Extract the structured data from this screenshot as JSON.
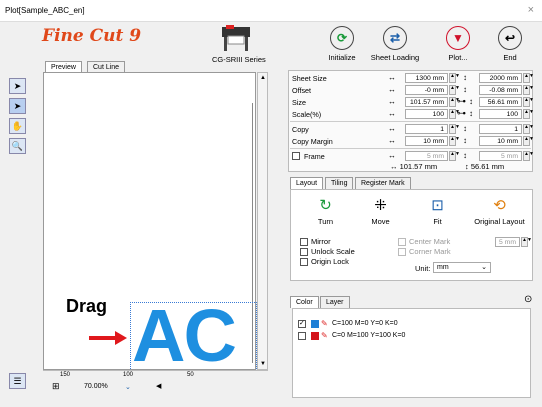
{
  "window": {
    "title": "Plot[Sample_ABC_en]",
    "close": "×"
  },
  "logo": "Fine Cut 9",
  "model": "CG-SRIII Series",
  "toolbar": [
    {
      "label": "Initialize",
      "glyph": "⟳",
      "color": "#1a9a3a"
    },
    {
      "label": "Sheet Loading",
      "glyph": "⇄",
      "color": "#1b5faa"
    },
    {
      "label": "Plot...",
      "glyph": "▼",
      "color": "#d0102a"
    },
    {
      "label": "End",
      "glyph": "↩",
      "color": "#222"
    }
  ],
  "preview_tabs": [
    "Preview",
    "Cut Line"
  ],
  "ruler": {
    "top": [
      "150",
      "100",
      "50",
      "0"
    ],
    "side": [
      "5",
      "1",
      "0",
      "0",
      "1",
      "5",
      "0",
      "1",
      "0",
      "0",
      "5",
      "0"
    ]
  },
  "canvas": {
    "drag_label": "Drag",
    "text": "AC"
  },
  "zoom": "70.00%",
  "params": [
    {
      "name": "Sheet Size",
      "w": "1300 mm",
      "h": "2000 mm"
    },
    {
      "name": "Offset",
      "w": "-0 mm",
      "h": "-0.08 mm"
    },
    {
      "name": "Size",
      "w": "101.57 mm",
      "h": "56.61 mm"
    },
    {
      "name": "Scale(%)",
      "w": "100",
      "h": "100"
    },
    {
      "name": "Copy",
      "w": "1",
      "h": "1"
    },
    {
      "name": "Copy Margin",
      "w": "10 mm",
      "h": "10 mm"
    },
    {
      "name": "Frame",
      "w": "5 mm",
      "h": "5 mm"
    }
  ],
  "total_size": {
    "w": "↔ 101.57 mm",
    "h": "↕ 56.61 mm"
  },
  "layout_tabs": [
    "Layout",
    "Tiling",
    "Register Mark"
  ],
  "layout_buttons": [
    "Turn",
    "Move",
    "Fit",
    "Original Layout"
  ],
  "options": {
    "mirror": "Mirror",
    "unlock_scale": "Unlock Scale",
    "origin_lock": "Origin Lock",
    "center_mark": "Center Mark",
    "corner_mark": "Corner Mark",
    "mark_value": "5 mm",
    "unit_label": "Unit:",
    "unit_value": "mm"
  },
  "color_tabs": [
    "Color",
    "Layer"
  ],
  "colors": [
    {
      "swatch": "#1e7fd6",
      "label": "C=100 M=0 Y=0 K=0",
      "checked": true
    },
    {
      "swatch": "#d4141c",
      "label": "C=0 M=100 Y=100 K=0",
      "checked": false
    }
  ]
}
